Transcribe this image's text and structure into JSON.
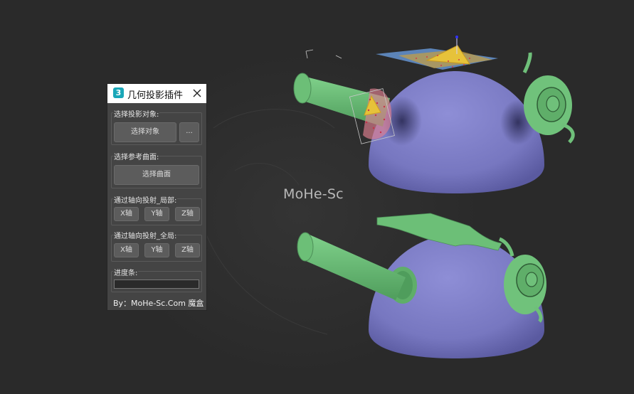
{
  "viewport": {
    "watermark": "MoHe-Sc"
  },
  "window": {
    "app_icon_text": "3",
    "title": "几何投影插件",
    "close_label": "close"
  },
  "groups": {
    "select_target": {
      "label": "选择投影对象:",
      "select_button": "选择对象",
      "more_button": "..."
    },
    "select_surface": {
      "label": "选择参考曲面:",
      "select_button": "选择曲面"
    },
    "axis_local": {
      "label": "通过轴向投射_局部:",
      "x": "X轴",
      "y": "Y轴",
      "z": "Z轴"
    },
    "axis_global": {
      "label": "通过轴向投射_全局:",
      "x": "X轴",
      "y": "Y轴",
      "z": "Z轴"
    },
    "progress": {
      "label": "进度条:",
      "value": 0
    }
  },
  "footer": {
    "text": "By：MoHe-Sc.Com 魔盒"
  },
  "colors": {
    "viewport_bg": "#2a2a2a",
    "dome": "#7f7fc6",
    "geometry": "#6fc07a",
    "panel_bg": "#444444",
    "button": "#5c5c5c"
  }
}
